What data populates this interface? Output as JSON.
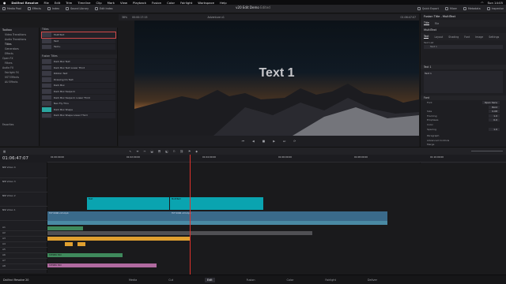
{
  "macbar": {
    "menus": [
      "DaVinci Resolve",
      "File",
      "Edit",
      "Trim",
      "Timeline",
      "Clip",
      "Mark",
      "View",
      "Playback",
      "Fusion",
      "Color",
      "Fairlight",
      "Workspace",
      "Help"
    ],
    "right": [
      "Sun 14:05"
    ]
  },
  "toolbar": {
    "items": [
      "Media Pool",
      "Effects",
      "Index",
      "Sound Library",
      "Edit Index"
    ],
    "right_items": [
      "Quick Export",
      "Mixer",
      "Metadata",
      "Inspector"
    ],
    "project_title": "v20 Edit Demo",
    "edited": "Edited"
  },
  "effects_sidebar": {
    "items": [
      "Toolbox",
      "Video Transitions",
      "Audio Transitions",
      "Titles",
      "Generators",
      "Effects",
      "Open FX",
      "Filters",
      "Audio FX",
      "Fairlight FX",
      "VST Effects",
      "AU Effects",
      "Favorites"
    ]
  },
  "titles_list": {
    "header": "Titles",
    "items": [
      "MultiText",
      "Text",
      "Text+"
    ],
    "fusion_header": "Fusion Titles",
    "fusion_items": [
      "Dark Box Text",
      "Dark Box Text Lower Third",
      "Ribbon Text",
      "Drawing On Text",
      "Dark Box",
      "Dark Box Swipe In",
      "Dark Box Swipe In Lower Third",
      "Neo Fly Thru",
      "Dark Box Shape",
      "Dark Box Shape Lower Third"
    ]
  },
  "viewer": {
    "zoom": "38%",
    "timecode_left": "00:00:17:15",
    "clip_name": "Adventure v1",
    "timecode_right": "01:06:47:07",
    "overlay_text": "Text 1"
  },
  "transport": {
    "buttons": [
      "⏮",
      "◀",
      "■",
      "▶",
      "⏭",
      "⟳"
    ]
  },
  "inspector": {
    "title": "Fusion Title - MultiText",
    "tabs": [
      "Title",
      "File"
    ],
    "subtitle": "MultiText",
    "subtabs": [
      "Text",
      "Layout",
      "Shading",
      "Font",
      "Image",
      "Settings"
    ],
    "text_list_label": "Text List",
    "text_item": "Text 1",
    "text_section": "Text 1",
    "text_value": "Text 1",
    "font_section": "Font",
    "fields": [
      {
        "label": "Font",
        "value": "Open Sans"
      },
      {
        "label": "",
        "value": "Bold"
      },
      {
        "label": "Size",
        "value": "0.08"
      },
      {
        "label": "Tracking",
        "value": "1.0"
      },
      {
        "label": "Emphasis",
        "value": "0.0"
      },
      {
        "label": "Color",
        "value": ""
      },
      {
        "label": "Spacing",
        "value": "1.0"
      }
    ],
    "collapsed": [
      "Paragraph",
      "Advanced Controls",
      "Merge"
    ]
  },
  "timeline": {
    "timecode": "01:06:47:07",
    "ruler_marks": [
      "01:00:00:00",
      "01:02:00:00",
      "01:04:00:00",
      "01:06:00:00",
      "01:08:00:00",
      "01:10:00:00"
    ],
    "video_tracks": [
      {
        "id": "V4",
        "name": "Video 4"
      },
      {
        "id": "V3",
        "name": "Video 3"
      },
      {
        "id": "V2",
        "name": "Video 2"
      },
      {
        "id": "V1",
        "name": "Video 1"
      }
    ],
    "audio_tracks": [
      "A1",
      "A2",
      "A3",
      "A4",
      "A5",
      "A6",
      "A7",
      "A8"
    ],
    "clips": [
      {
        "label": "Text"
      },
      {
        "label": "MultiText"
      },
      {
        "label": "TCF 0006 v13.mp4"
      },
      {
        "label": "TCF 0006 v13.mp4"
      },
      {
        "label": "STEREO MIX"
      },
      {
        "label": "STEREO MIX"
      }
    ]
  },
  "pages": [
    "Media",
    "Cut",
    "Edit",
    "Fusion",
    "Color",
    "Fairlight",
    "Deliver"
  ],
  "footer_brand": "DaVinci Resolve 20",
  "colors": {
    "accent_teal": "#0aa4b0",
    "playhead": "#e0322c",
    "orange_clip": "#e0a030"
  }
}
